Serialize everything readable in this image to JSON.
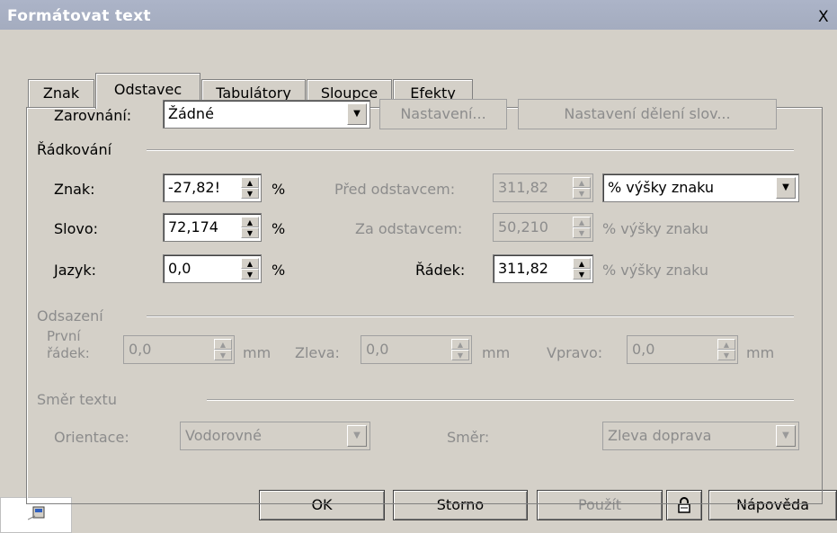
{
  "title": "Formátovat text",
  "close_label": "X",
  "tabs": [
    "Znak",
    "Odstavec",
    "Tabulátory",
    "Sloupce",
    "Efekty"
  ],
  "alignment": {
    "label": "Zarovnání:",
    "value": "Žádné",
    "settings_btn": "Nastavení...",
    "hyphen_btn": "Nastavení dělení slov..."
  },
  "spacing": {
    "section": "Řádkování",
    "char_label": "Znak:",
    "char_value": "-27,82!",
    "char_unit": "%",
    "word_label": "Slovo:",
    "word_value": "72,174",
    "word_unit": "%",
    "lang_label": "Jazyk:",
    "lang_value": "0,0",
    "lang_unit": "%",
    "before_label": "Před odstavcem:",
    "before_value": "311,82",
    "before_unit": "% výšky znaku",
    "after_label": "Za odstavcem:",
    "after_value": "50,210",
    "after_unit": "% výšky znaku",
    "line_label": "Řádek:",
    "line_value": "311,82",
    "line_unit": "% výšky znaku"
  },
  "indent": {
    "section": "Odsazení",
    "first_label_1": "První",
    "first_label_2": "řádek:",
    "first_value": "0,0",
    "first_unit": "mm",
    "left_label": "Zleva:",
    "left_value": "0,0",
    "left_unit": "mm",
    "right_label": "Vpravo:",
    "right_value": "0,0",
    "right_unit": "mm"
  },
  "direction": {
    "section": "Směr textu",
    "orientation_label": "Orientace:",
    "orientation_value": "Vodorovné",
    "dir_label": "Směr:",
    "dir_value": "Zleva doprava"
  },
  "buttons": {
    "ok": "OK",
    "cancel": "Storno",
    "apply": "Použít",
    "help": "Nápověda"
  }
}
